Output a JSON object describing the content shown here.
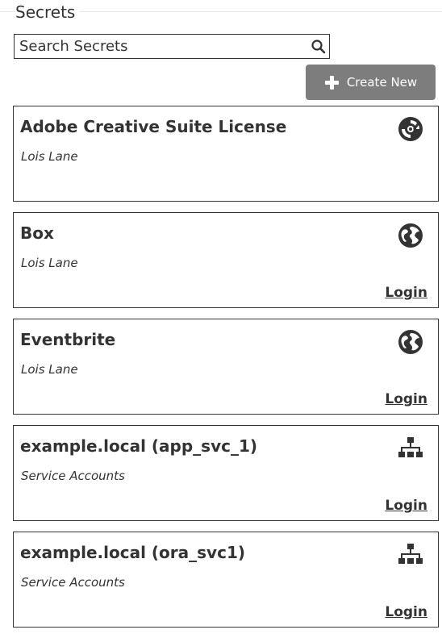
{
  "header": {
    "title": "Secrets"
  },
  "search": {
    "placeholder": "Search Secrets"
  },
  "toolbar": {
    "create_label": "Create New"
  },
  "secrets": [
    {
      "name": "Adobe Creative Suite License",
      "owner": "Lois Lane",
      "icon": "disc-icon",
      "login_label": ""
    },
    {
      "name": "Box",
      "owner": "Lois Lane",
      "icon": "globe-icon",
      "login_label": "Login"
    },
    {
      "name": "Eventbrite",
      "owner": "Lois Lane",
      "icon": "globe-icon",
      "login_label": "Login"
    },
    {
      "name": "example.local (app_svc_1)",
      "owner": "Service Accounts",
      "icon": "network-icon",
      "login_label": "Login"
    },
    {
      "name": "example.local (ora_svc1)",
      "owner": "Service Accounts",
      "icon": "network-icon",
      "login_label": "Login"
    }
  ],
  "colors": {
    "text": "#333333",
    "button_bg": "#7d7d7d",
    "button_text": "#ffffff",
    "border": "#333333"
  }
}
